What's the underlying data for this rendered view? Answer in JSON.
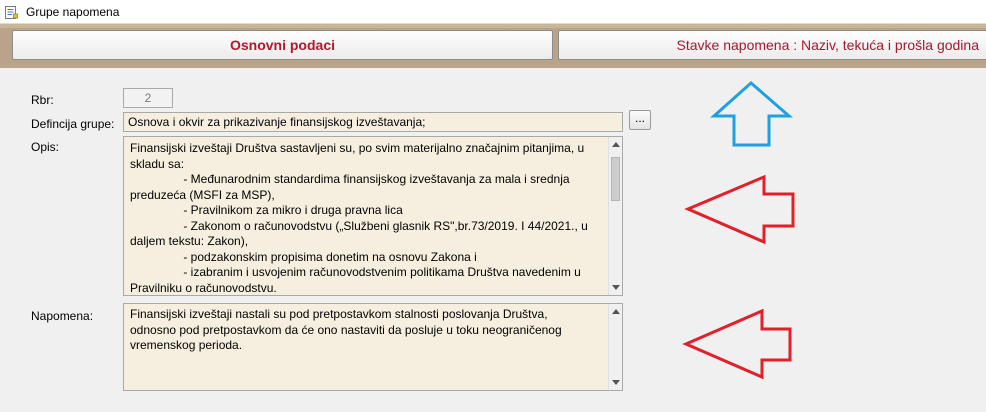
{
  "window": {
    "title": "Grupe napomena"
  },
  "tabs": [
    {
      "label": "Osnovni podaci"
    },
    {
      "label": "Stavke napomena : Naziv, tekuća i prošla godina"
    }
  ],
  "form": {
    "rbr_label": "Rbr:",
    "rbr_value": "2",
    "definicija_label": "Defincija grupe:",
    "definicija_value": "Osnova i okvir za prikazivanje finansijskog izveštavanja;",
    "lookup_button_label": "...",
    "opis_label": "Opis:",
    "opis_lines": [
      "Finansijski izveštaji Društva sastavljeni su, po svim materijalno značajnim pitanjima, u",
      "skladu sa:",
      "                - Međunarodnim standardima finansijskog izveštavanja za mala i srednja",
      "preduzeća (MSFI za MSP),",
      "                - Pravilnikom za mikro i druga pravna lica",
      "                - Zakonom o računovodstvu („Službeni glasnik RS\",br.73/2019. I 44/2021., u",
      "daljem tekstu: Zakon),",
      "                - podzakonskim propisima donetim na osnovu Zakona i",
      "                - izabranim i usvojenim računovodstvenim politikama Društva navedenim u",
      "Pravilniku o računovodstvu."
    ],
    "napomena_label": "Napomena:",
    "napomena_lines": [
      "Finansijski izveštaji nastali su pod pretpostavkom stalnosti poslovanja Društva,",
      "odnosno pod pretpostavkom da će ono nastaviti da posluje u toku neograničenog",
      "vremenskog perioda."
    ]
  },
  "colors": {
    "tab_band": "#b9a48a",
    "field_bg": "#f6efdf",
    "tab_text": "#b1182a",
    "blue_arrow": "#1ea0e6",
    "red_arrow": "#e0202a"
  },
  "icons": {
    "window": "form-icon",
    "annotation_up": "arrow-up-outline-icon",
    "annotation_left": "arrow-left-outline-icon"
  }
}
